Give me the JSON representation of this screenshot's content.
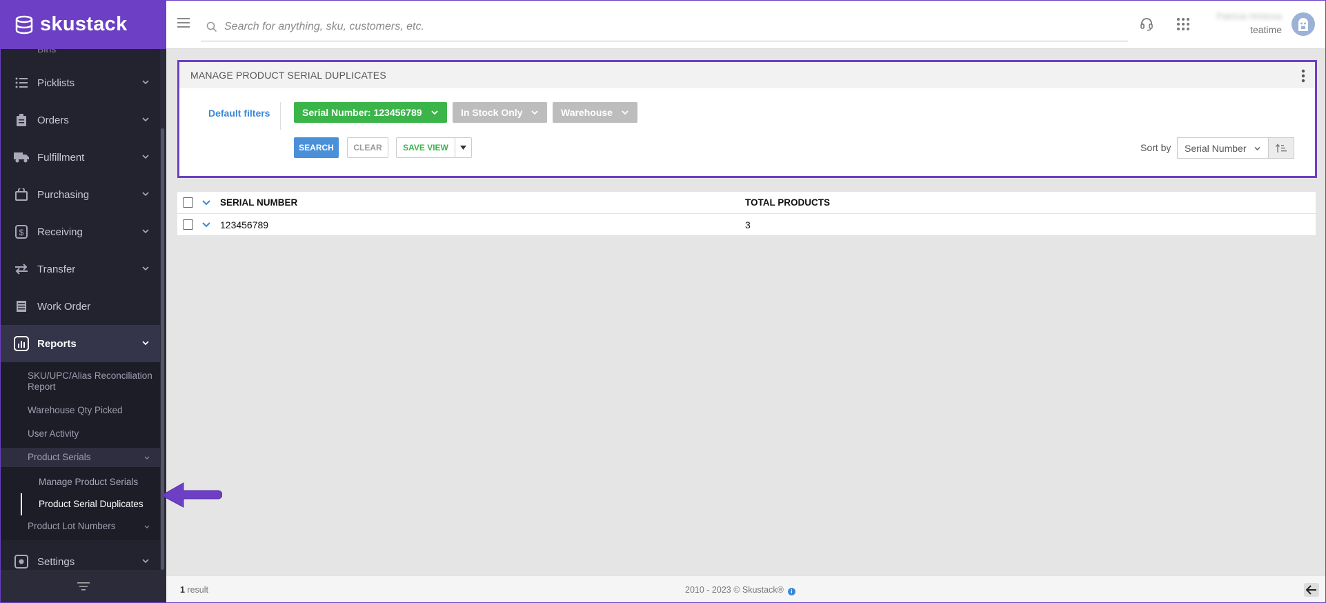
{
  "app": {
    "name": "skustack",
    "accent": "#6c3fc4"
  },
  "search": {
    "placeholder": "Search for anything, sku, customers, etc."
  },
  "user": {
    "name": "Patricia Hristova",
    "org": "teatime"
  },
  "sidebar": {
    "partial_item": "Bins",
    "items": [
      {
        "label": "Picklists",
        "icon": "list-icon"
      },
      {
        "label": "Orders",
        "icon": "clipboard-icon"
      },
      {
        "label": "Fulfillment",
        "icon": "truck-icon"
      },
      {
        "label": "Purchasing",
        "icon": "bag-icon"
      },
      {
        "label": "Receiving",
        "icon": "dollar-icon"
      },
      {
        "label": "Transfer",
        "icon": "transfer-icon"
      },
      {
        "label": "Work Order",
        "icon": "table-icon"
      },
      {
        "label": "Reports",
        "icon": "chart-icon"
      }
    ],
    "reports_sub": {
      "item1": "SKU/UPC/Alias Reconciliation Report",
      "item2": "Warehouse Qty Picked",
      "item3": "User Activity",
      "group1": "Product Serials",
      "group1_items": [
        "Manage Product Serials",
        "Product Serial Duplicates"
      ],
      "group2": "Product Lot Numbers"
    },
    "settings": "Settings"
  },
  "panel": {
    "title": "MANAGE PRODUCT SERIAL DUPLICATES",
    "default_filters": "Default filters",
    "filters": {
      "serial": "Serial Number: 123456789",
      "stock": "In Stock Only",
      "warehouse": "Warehouse"
    },
    "buttons": {
      "search": "SEARCH",
      "clear": "CLEAR",
      "save_view": "SAVE VIEW"
    },
    "sort_label": "Sort by",
    "sort_value": "Serial Number"
  },
  "table": {
    "headers": {
      "serial": "SERIAL NUMBER",
      "total": "TOTAL PRODUCTS"
    },
    "rows": [
      {
        "serial": "123456789",
        "total": "3"
      }
    ]
  },
  "footer": {
    "count": "1",
    "count_suffix": " result",
    "copyright": "2010 - 2023 © Skustack®"
  }
}
